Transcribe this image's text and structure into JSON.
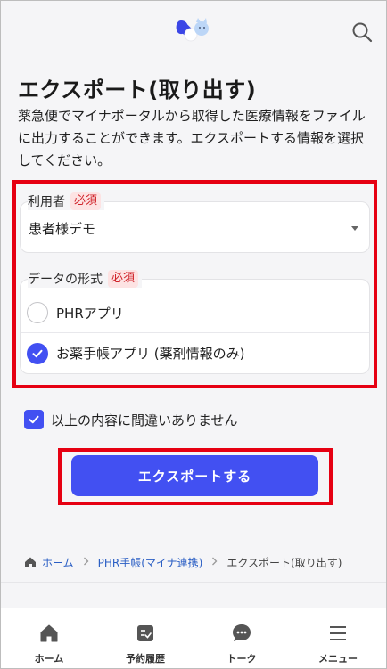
{
  "header": {
    "logo_icon": "app-logo-icon",
    "search_icon": "search-icon"
  },
  "page": {
    "title": "エクスポート(取り出す)",
    "description": "薬急便でマイナポータルから取得した医療情報をファイルに出力することができます。エクスポートする情報を選択してください。"
  },
  "form": {
    "user": {
      "label": "利用者",
      "required": "必須",
      "value": "患者様デモ"
    },
    "format": {
      "label": "データの形式",
      "required": "必須",
      "options": [
        {
          "label": "PHRアプリ",
          "checked": false
        },
        {
          "label": "お薬手帳アプリ (薬剤情報のみ)",
          "checked": true
        }
      ]
    },
    "confirm": {
      "label": "以上の内容に間違いありません",
      "checked": true
    },
    "submit_label": "エクスポートする"
  },
  "breadcrumb": {
    "home": "ホーム",
    "parent": "PHR手帳(マイナ連携)",
    "current": "エクスポート(取り出す)"
  },
  "bottom_nav": {
    "items": [
      {
        "label": "ホーム",
        "icon": "home-icon"
      },
      {
        "label": "予約履歴",
        "icon": "reservation-history-icon"
      },
      {
        "label": "トーク",
        "icon": "chat-icon"
      },
      {
        "label": "メニュー",
        "icon": "menu-icon"
      }
    ]
  },
  "colors": {
    "primary": "#4250f2",
    "required_text": "#d0242b",
    "highlight_border": "#e60012"
  }
}
